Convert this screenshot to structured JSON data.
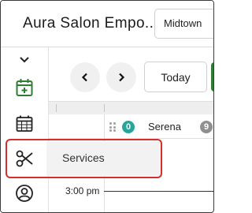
{
  "header": {
    "title": "Aura Salon Empo..",
    "location": "Midtown"
  },
  "sidebar": {
    "items": [
      {
        "icon": "chevron-down-icon"
      },
      {
        "icon": "calendar-add-icon",
        "color": "#2e7d32"
      },
      {
        "icon": "calendar-grid-icon"
      },
      {
        "icon": "scissors-icon"
      },
      {
        "icon": "user-circle-icon"
      }
    ]
  },
  "toolbar": {
    "prev_icon": "chevron-left-icon",
    "next_icon": "chevron-right-icon",
    "today_label": "Today"
  },
  "calendar": {
    "staff": [
      {
        "count": "0",
        "badge_color": "#26a69a",
        "name": "Serena"
      },
      {
        "count": "9",
        "badge_color": "#8f8f8f"
      }
    ],
    "time_label": "3:00 pm"
  },
  "tooltip": {
    "label": "Services"
  },
  "colors": {
    "accent_green": "#2e7d32",
    "highlight_red": "#d32f2f"
  }
}
